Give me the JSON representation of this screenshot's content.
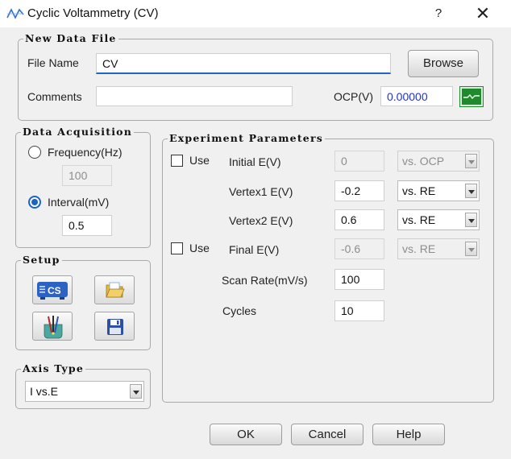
{
  "window": {
    "title": "Cyclic Voltammetry (CV)",
    "help_glyph": "?",
    "close_glyph": "✕"
  },
  "new_data_file": {
    "legend": "New Data File",
    "file_name_label": "File Name",
    "file_name_value": "CV",
    "browse_label": "Browse",
    "comments_label": "Comments",
    "comments_value": "",
    "ocp_label": "OCP(V)",
    "ocp_value": "0.00000"
  },
  "data_acquisition": {
    "legend": "Data Acquisition",
    "frequency_label": "Frequency(Hz)",
    "frequency_value": "100",
    "frequency_selected": false,
    "interval_label": "Interval(mV)",
    "interval_value": "0.5",
    "interval_selected": true
  },
  "setup": {
    "legend": "Setup",
    "buttons": [
      {
        "icon": "cs-device-icon"
      },
      {
        "icon": "folder-open-icon"
      },
      {
        "icon": "electrode-icon"
      },
      {
        "icon": "save-disk-icon"
      }
    ],
    "cs_text": "CS"
  },
  "axis_type": {
    "legend": "Axis Type",
    "value": "I vs.E"
  },
  "experiment_parameters": {
    "legend": "Experiment Parameters",
    "use_label": "Use",
    "initial_e_label": "Initial E(V)",
    "initial_e_value": "0",
    "initial_e_ref": "vs. OCP",
    "initial_e_use": false,
    "vertex1_label": "Vertex1 E(V)",
    "vertex1_value": "-0.2",
    "vertex1_ref": "vs. RE",
    "vertex2_label": "Vertex2 E(V)",
    "vertex2_value": "0.6",
    "vertex2_ref": "vs. RE",
    "final_e_label": "Final E(V)",
    "final_e_value": "-0.6",
    "final_e_ref": "vs. RE",
    "final_e_use": false,
    "scan_rate_label": "Scan Rate(mV/s)",
    "scan_rate_value": "100",
    "cycles_label": "Cycles",
    "cycles_value": "10"
  },
  "footer": {
    "ok_label": "OK",
    "cancel_label": "Cancel",
    "help_label": "Help"
  },
  "colors": {
    "accent": "#1a63c9",
    "ocp_value": "#2033c8",
    "graph_icon": "#1e8a2c"
  }
}
